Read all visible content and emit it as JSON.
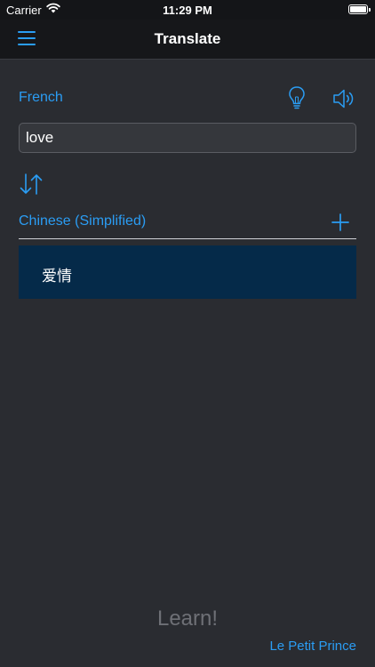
{
  "status": {
    "carrier": "Carrier",
    "time": "11:29 PM"
  },
  "nav": {
    "title": "Translate",
    "menu_icon": "hamburger-menu-icon"
  },
  "source": {
    "language": "French",
    "input_value": "love",
    "input_placeholder": "",
    "hint_icon": "lightbulb-icon",
    "speak_icon": "speaker-icon"
  },
  "swap_icon": "swap-arrows-icon",
  "target": {
    "language": "Chinese (Simplified)",
    "add_icon": "plus-icon",
    "result": "爱情"
  },
  "learn_label": "Learn!",
  "footer_link": "Le Petit Prince",
  "colors": {
    "accent": "#2a9df4",
    "background": "#2a2c31",
    "navbar": "#16171a",
    "result_background": "#052a49"
  }
}
